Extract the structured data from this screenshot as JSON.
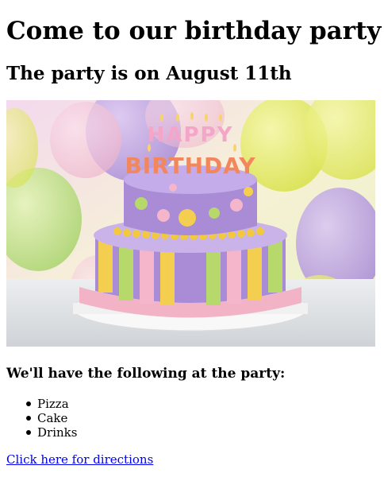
{
  "heading": "Come to our birthday party!",
  "date_line": "The party is on August 11th",
  "image": {
    "description_icon": "birthday-cake-image",
    "candle_text": "HAPPY BIRTHDAY"
  },
  "list_intro": "We'll have the following at the party:",
  "items": [
    "Pizza",
    "Cake",
    "Drinks"
  ],
  "directions_link": "Click here for directions",
  "colors": {
    "link": "#0000ee",
    "cake_purple": "#a98bd6",
    "cake_yellow": "#f4cf4f",
    "cake_pink": "#f5b6cc",
    "cake_green": "#b7d86a"
  }
}
